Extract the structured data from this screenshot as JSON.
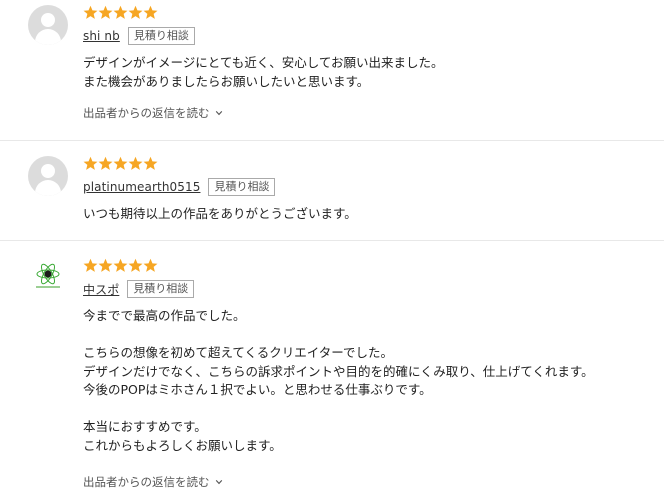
{
  "colors": {
    "star": "#f6a623",
    "divider": "#e8e8e8",
    "logo_green": "#3aa935"
  },
  "reviews": [
    {
      "avatar": "default-user-icon",
      "rating": 5,
      "username": "shi nb",
      "badge": "見積り相談",
      "body": "デザインがイメージにとても近く、安心してお願い出来ました。\nまた機会がありましたらお願いしたいと思います。",
      "reply_link": "出品者からの返信を読む"
    },
    {
      "avatar": "default-user-icon",
      "rating": 5,
      "username": "platinumearth0515",
      "badge": "見積り相談",
      "body": "いつも期待以上の作品をありがとうございます。"
    },
    {
      "avatar": "atom-logo-icon",
      "rating": 5,
      "username": "中スポ",
      "badge": "見積り相談",
      "body": "今までで最高の作品でした。\n\nこちらの想像を初めて超えてくるクリエイターでした。\nデザインだけでなく、こちらの訴求ポイントや目的を的確にくみ取り、仕上げてくれます。\n今後のPOPはミホさん１択でよい。と思わせる仕事ぶりです。\n\n本当におすすめです。\nこれからもよろしくお願いします。",
      "reply_link": "出品者からの返信を読む"
    }
  ]
}
